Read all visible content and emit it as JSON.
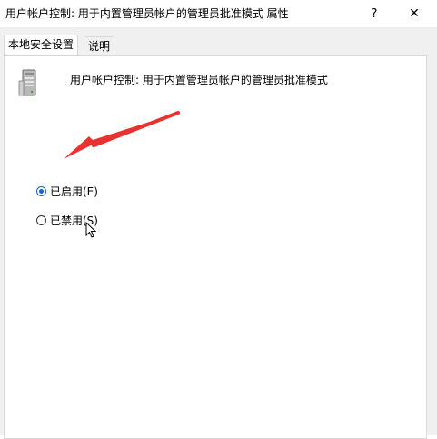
{
  "window": {
    "title": "用户帐户控制: 用于内置管理员帐户的管理员批准模式 属性",
    "help_glyph": "?",
    "close_glyph": "✕"
  },
  "tabs": [
    {
      "label": "本地安全设置",
      "active": true
    },
    {
      "label": "说明",
      "active": false
    }
  ],
  "policy": {
    "icon": "server-icon",
    "name": "用户帐户控制: 用于内置管理员帐户的管理员批准模式"
  },
  "options": [
    {
      "label": "已启用(E)",
      "checked": true
    },
    {
      "label": "已禁用(S)",
      "checked": false
    }
  ],
  "colors": {
    "annotation_arrow": "#e8322f",
    "radio_selected": "#1a5fd6"
  }
}
